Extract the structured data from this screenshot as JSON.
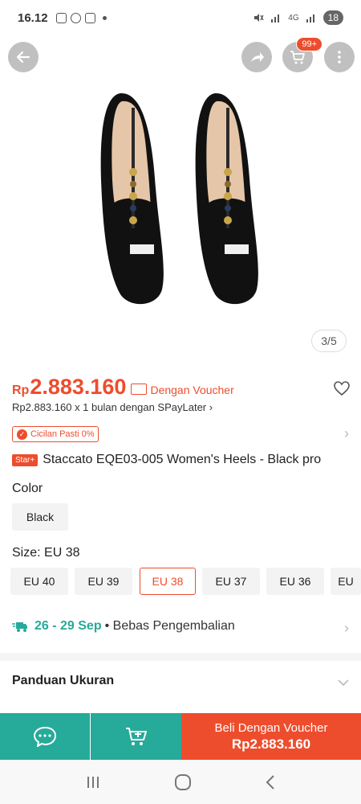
{
  "status": {
    "time": "16.12",
    "battery": "18",
    "net": "4G"
  },
  "header": {
    "cart_badge": "99+",
    "image_counter": "3/5"
  },
  "price": {
    "currency": "Rp",
    "value": "2.883.160",
    "voucher_label": "Dengan Voucher",
    "spaylater": "Rp2.883.160 x 1 bulan dengan SPayLater ›"
  },
  "promo": {
    "cicilan": "Cicilan Pasti 0%",
    "star_badge": "Star+"
  },
  "product": {
    "title": "Staccato EQE03-005 Women's Heels - Black pro"
  },
  "color": {
    "label": "Color",
    "options": [
      "Black"
    ],
    "selected": "Black"
  },
  "size": {
    "label": "Size: EU 38",
    "options": [
      "EU 40",
      "EU 39",
      "EU 38",
      "EU 37",
      "EU 36",
      "EU"
    ],
    "selected": "EU 38"
  },
  "shipping": {
    "date": "26 - 29 Sep",
    "rest": "• Bebas Pengembalian"
  },
  "guide": {
    "label": "Panduan Ukuran"
  },
  "action": {
    "buy_line1": "Beli Dengan Voucher",
    "buy_line2": "Rp2.883.160"
  },
  "colors": {
    "accent": "#ee4d2d",
    "teal": "#26aa99"
  },
  "icons": [
    "back-icon",
    "share-icon",
    "cart-icon",
    "more-icon",
    "heart-icon",
    "chat-icon",
    "add-to-cart-icon"
  ]
}
